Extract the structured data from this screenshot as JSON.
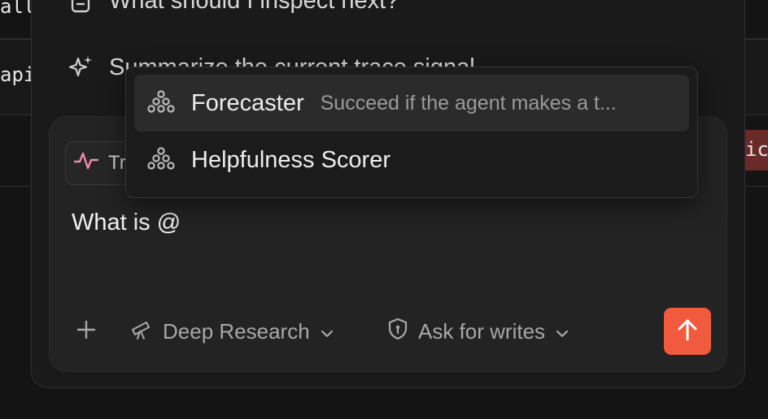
{
  "background": {
    "row1_text": "all",
    "row2_text": "api",
    "right_badge_text": "ica"
  },
  "suggestions": [
    {
      "label": "What should I inspect next?",
      "icon": "document-icon"
    },
    {
      "label": "Summarize the current trace signal",
      "icon": "sparkles-icon"
    }
  ],
  "composer": {
    "chip_label": "Trace",
    "chip_icon": "activity-icon",
    "input_value": "What is @",
    "mode_label": "Deep Research",
    "mode_icon": "telescope-icon",
    "permission_label": "Ask for writes",
    "permission_icon": "shield-icon",
    "send_icon": "arrow-up-icon"
  },
  "mention_popup": {
    "items": [
      {
        "name": "Forecaster",
        "description": "Succeed if the agent makes a t...",
        "icon": "scorer-icon",
        "active": true
      },
      {
        "name": "Helpfulness Scorer",
        "description": "",
        "icon": "scorer-icon",
        "active": false
      }
    ]
  },
  "colors": {
    "accent": "#f05a3e",
    "chip_icon": "#f08aa8",
    "badge_bg": "#6a2a2a"
  }
}
